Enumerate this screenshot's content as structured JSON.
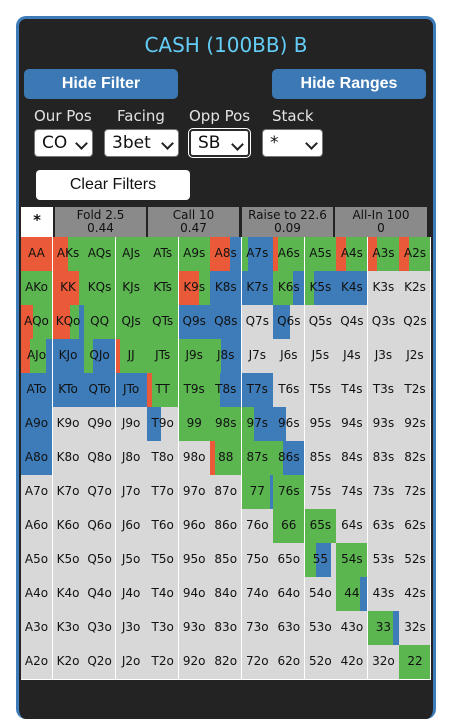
{
  "title": "CASH (100BB) B",
  "buttons": {
    "hide_filter": "Hide Filter",
    "hide_ranges": "Hide Ranges",
    "clear_filters": "Clear Filters"
  },
  "filters": [
    {
      "label": "Our Pos",
      "value": "CO"
    },
    {
      "label": "Facing",
      "value": "3bet"
    },
    {
      "label": "Opp Pos",
      "value": "SB"
    },
    {
      "label": "Stack",
      "value": "*"
    }
  ],
  "action_tabs": [
    {
      "label": "*",
      "value": ""
    },
    {
      "label": "Fold 2.5",
      "value": "0.44"
    },
    {
      "label": "Call 10",
      "value": "0.47"
    },
    {
      "label": "Raise to 22.6",
      "value": "0.09"
    },
    {
      "label": "All-In 100",
      "value": "0"
    }
  ],
  "colors": {
    "fold": "#d8d8d8",
    "call": "#5bb650",
    "raise": "#3d7cb8",
    "allin": "#eb5a38",
    "panel": "#232323",
    "accent": "#3c79b4"
  },
  "hands": [
    [
      "AA",
      "AKs",
      "AQs",
      "AJs",
      "ATs",
      "A9s",
      "A8s",
      "A7s",
      "A6s",
      "A5s",
      "A4s",
      "A3s",
      "A2s"
    ],
    [
      "AKo",
      "KK",
      "KQs",
      "KJs",
      "KTs",
      "K9s",
      "K8s",
      "K7s",
      "K6s",
      "K5s",
      "K4s",
      "K3s",
      "K2s"
    ],
    [
      "AQo",
      "KQo",
      "QQ",
      "QJs",
      "QTs",
      "Q9s",
      "Q8s",
      "Q7s",
      "Q6s",
      "Q5s",
      "Q4s",
      "Q3s",
      "Q2s"
    ],
    [
      "AJo",
      "KJo",
      "QJo",
      "JJ",
      "JTs",
      "J9s",
      "J8s",
      "J7s",
      "J6s",
      "J5s",
      "J4s",
      "J3s",
      "J2s"
    ],
    [
      "ATo",
      "KTo",
      "QTo",
      "JTo",
      "TT",
      "T9s",
      "T8s",
      "T7s",
      "T6s",
      "T5s",
      "T4s",
      "T3s",
      "T2s"
    ],
    [
      "A9o",
      "K9o",
      "Q9o",
      "J9o",
      "T9o",
      "99",
      "98s",
      "97s",
      "96s",
      "95s",
      "94s",
      "93s",
      "92s"
    ],
    [
      "A8o",
      "K8o",
      "Q8o",
      "J8o",
      "T8o",
      "98o",
      "88",
      "87s",
      "86s",
      "85s",
      "84s",
      "83s",
      "82s"
    ],
    [
      "A7o",
      "K7o",
      "Q7o",
      "J7o",
      "T7o",
      "97o",
      "87o",
      "77",
      "76s",
      "75s",
      "74s",
      "73s",
      "72s"
    ],
    [
      "A6o",
      "K6o",
      "Q6o",
      "J6o",
      "T6o",
      "96o",
      "86o",
      "76o",
      "66",
      "65s",
      "64s",
      "63s",
      "62s"
    ],
    [
      "A5o",
      "K5o",
      "Q5o",
      "J5o",
      "T5o",
      "95o",
      "85o",
      "75o",
      "65o",
      "55",
      "54s",
      "53s",
      "52s"
    ],
    [
      "A4o",
      "K4o",
      "Q4o",
      "J4o",
      "T4o",
      "94o",
      "84o",
      "74o",
      "64o",
      "54o",
      "44",
      "43s",
      "42s"
    ],
    [
      "A3o",
      "K3o",
      "Q3o",
      "J3o",
      "T3o",
      "93o",
      "83o",
      "73o",
      "63o",
      "53o",
      "43o",
      "33",
      "32s"
    ],
    [
      "A2o",
      "K2o",
      "Q2o",
      "J2o",
      "T2o",
      "92o",
      "82o",
      "72o",
      "62o",
      "52o",
      "42o",
      "32o",
      "22"
    ]
  ],
  "frequencies": [
    [
      [
        0,
        0,
        0,
        1
      ],
      [
        0,
        0.5,
        0,
        0.5
      ],
      [
        0,
        1,
        0,
        0
      ],
      [
        0,
        1,
        0,
        0
      ],
      [
        0,
        1,
        0,
        0
      ],
      [
        0,
        1,
        0,
        0
      ],
      [
        0,
        0,
        0.35,
        0.65
      ],
      [
        0,
        0.2,
        0.8,
        0
      ],
      [
        0,
        0.85,
        0,
        0.15
      ],
      [
        0,
        1,
        0,
        0
      ],
      [
        0,
        0.7,
        0,
        0.3
      ],
      [
        0,
        0.7,
        0,
        0.3
      ],
      [
        0,
        0.7,
        0,
        0.3
      ]
    ],
    [
      [
        0,
        1,
        0,
        0
      ],
      [
        0,
        0.15,
        0,
        0.85
      ],
      [
        0,
        1,
        0,
        0
      ],
      [
        0,
        1,
        0,
        0
      ],
      [
        0,
        1,
        0,
        0
      ],
      [
        0,
        0.35,
        0,
        0.65
      ],
      [
        0,
        0,
        1,
        0
      ],
      [
        0,
        0,
        1,
        0
      ],
      [
        0,
        0.65,
        0.35,
        0
      ],
      [
        0,
        0.3,
        0.7,
        0
      ],
      [
        0,
        0,
        1,
        0
      ],
      [
        1,
        0,
        0,
        0
      ],
      [
        1,
        0,
        0,
        0
      ]
    ],
    [
      [
        0,
        0.6,
        0,
        0.4
      ],
      [
        0,
        0.3,
        0.15,
        0.55
      ],
      [
        0,
        1,
        0,
        0
      ],
      [
        0,
        1,
        0,
        0
      ],
      [
        0,
        1,
        0,
        0
      ],
      [
        0,
        0,
        1,
        0
      ],
      [
        0,
        0,
        1,
        0
      ],
      [
        1,
        0,
        0,
        0
      ],
      [
        0.45,
        0,
        0.55,
        0
      ],
      [
        1,
        0,
        0,
        0
      ],
      [
        1,
        0,
        0,
        0
      ],
      [
        1,
        0,
        0,
        0
      ],
      [
        1,
        0,
        0,
        0
      ]
    ],
    [
      [
        0,
        0.5,
        0.2,
        0.3
      ],
      [
        0,
        0,
        1,
        0
      ],
      [
        0,
        0.3,
        0.7,
        0
      ],
      [
        0,
        0.85,
        0,
        0.15
      ],
      [
        0,
        1,
        0,
        0
      ],
      [
        0,
        1,
        0,
        0
      ],
      [
        0,
        0.35,
        0.65,
        0
      ],
      [
        1,
        0,
        0,
        0
      ],
      [
        1,
        0,
        0,
        0
      ],
      [
        1,
        0,
        0,
        0
      ],
      [
        1,
        0,
        0,
        0
      ],
      [
        1,
        0,
        0,
        0
      ],
      [
        1,
        0,
        0,
        0
      ]
    ],
    [
      [
        0,
        0,
        1,
        0
      ],
      [
        0,
        0,
        1,
        0
      ],
      [
        0,
        0,
        1,
        0
      ],
      [
        0,
        0,
        1,
        0
      ],
      [
        0,
        0.85,
        0,
        0.15
      ],
      [
        0,
        1,
        0,
        0
      ],
      [
        0,
        0.3,
        0.7,
        0
      ],
      [
        0,
        0,
        1,
        0
      ],
      [
        1,
        0,
        0,
        0
      ],
      [
        1,
        0,
        0,
        0
      ],
      [
        1,
        0,
        0,
        0
      ],
      [
        1,
        0,
        0,
        0
      ],
      [
        1,
        0,
        0,
        0
      ]
    ],
    [
      [
        0,
        0,
        1,
        0
      ],
      [
        1,
        0,
        0,
        0
      ],
      [
        1,
        0,
        0,
        0
      ],
      [
        1,
        0,
        0,
        0
      ],
      [
        0.55,
        0,
        0.45,
        0
      ],
      [
        0,
        1,
        0,
        0
      ],
      [
        0,
        1,
        0,
        0
      ],
      [
        0,
        0.4,
        0.6,
        0
      ],
      [
        0.6,
        0,
        0.4,
        0
      ],
      [
        1,
        0,
        0,
        0
      ],
      [
        1,
        0,
        0,
        0
      ],
      [
        1,
        0,
        0,
        0
      ],
      [
        1,
        0,
        0,
        0
      ]
    ],
    [
      [
        0,
        0,
        1,
        0
      ],
      [
        1,
        0,
        0,
        0
      ],
      [
        1,
        0,
        0,
        0
      ],
      [
        1,
        0,
        0,
        0
      ],
      [
        1,
        0,
        0,
        0
      ],
      [
        1,
        0,
        0,
        0
      ],
      [
        0,
        0.85,
        0,
        0.15
      ],
      [
        0,
        1,
        0,
        0
      ],
      [
        0,
        0.3,
        0.7,
        0
      ],
      [
        1,
        0,
        0,
        0
      ],
      [
        1,
        0,
        0,
        0
      ],
      [
        1,
        0,
        0,
        0
      ],
      [
        1,
        0,
        0,
        0
      ]
    ],
    [
      [
        1,
        0,
        0,
        0
      ],
      [
        1,
        0,
        0,
        0
      ],
      [
        1,
        0,
        0,
        0
      ],
      [
        1,
        0,
        0,
        0
      ],
      [
        1,
        0,
        0,
        0
      ],
      [
        1,
        0,
        0,
        0
      ],
      [
        1,
        0,
        0,
        0
      ],
      [
        0,
        0.9,
        0.1,
        0
      ],
      [
        0,
        1,
        0,
        0
      ],
      [
        1,
        0,
        0,
        0
      ],
      [
        1,
        0,
        0,
        0
      ],
      [
        1,
        0,
        0,
        0
      ],
      [
        1,
        0,
        0,
        0
      ]
    ],
    [
      [
        1,
        0,
        0,
        0
      ],
      [
        1,
        0,
        0,
        0
      ],
      [
        1,
        0,
        0,
        0
      ],
      [
        1,
        0,
        0,
        0
      ],
      [
        1,
        0,
        0,
        0
      ],
      [
        1,
        0,
        0,
        0
      ],
      [
        1,
        0,
        0,
        0
      ],
      [
        1,
        0,
        0,
        0
      ],
      [
        0,
        1,
        0,
        0
      ],
      [
        0,
        1,
        0,
        0
      ],
      [
        1,
        0,
        0,
        0
      ],
      [
        1,
        0,
        0,
        0
      ],
      [
        1,
        0,
        0,
        0
      ]
    ],
    [
      [
        1,
        0,
        0,
        0
      ],
      [
        1,
        0,
        0,
        0
      ],
      [
        1,
        0,
        0,
        0
      ],
      [
        1,
        0,
        0,
        0
      ],
      [
        1,
        0,
        0,
        0
      ],
      [
        1,
        0,
        0,
        0
      ],
      [
        1,
        0,
        0,
        0
      ],
      [
        1,
        0,
        0,
        0
      ],
      [
        1,
        0,
        0,
        0
      ],
      [
        0.15,
        0.35,
        0.5,
        0
      ],
      [
        0,
        1,
        0,
        0
      ],
      [
        1,
        0,
        0,
        0
      ],
      [
        1,
        0,
        0,
        0
      ]
    ],
    [
      [
        1,
        0,
        0,
        0
      ],
      [
        1,
        0,
        0,
        0
      ],
      [
        1,
        0,
        0,
        0
      ],
      [
        1,
        0,
        0,
        0
      ],
      [
        1,
        0,
        0,
        0
      ],
      [
        1,
        0,
        0,
        0
      ],
      [
        1,
        0,
        0,
        0
      ],
      [
        1,
        0,
        0,
        0
      ],
      [
        1,
        0,
        0,
        0
      ],
      [
        1,
        0,
        0,
        0
      ],
      [
        0,
        0.75,
        0.25,
        0
      ],
      [
        1,
        0,
        0,
        0
      ],
      [
        1,
        0,
        0,
        0
      ]
    ],
    [
      [
        1,
        0,
        0,
        0
      ],
      [
        1,
        0,
        0,
        0
      ],
      [
        1,
        0,
        0,
        0
      ],
      [
        1,
        0,
        0,
        0
      ],
      [
        1,
        0,
        0,
        0
      ],
      [
        1,
        0,
        0,
        0
      ],
      [
        1,
        0,
        0,
        0
      ],
      [
        1,
        0,
        0,
        0
      ],
      [
        1,
        0,
        0,
        0
      ],
      [
        1,
        0,
        0,
        0
      ],
      [
        1,
        0,
        0,
        0
      ],
      [
        0,
        0.8,
        0.2,
        0
      ],
      [
        1,
        0,
        0,
        0
      ]
    ],
    [
      [
        1,
        0,
        0,
        0
      ],
      [
        1,
        0,
        0,
        0
      ],
      [
        1,
        0,
        0,
        0
      ],
      [
        1,
        0,
        0,
        0
      ],
      [
        1,
        0,
        0,
        0
      ],
      [
        1,
        0,
        0,
        0
      ],
      [
        1,
        0,
        0,
        0
      ],
      [
        1,
        0,
        0,
        0
      ],
      [
        1,
        0,
        0,
        0
      ],
      [
        1,
        0,
        0,
        0
      ],
      [
        1,
        0,
        0,
        0
      ],
      [
        1,
        0,
        0,
        0
      ],
      [
        0,
        1,
        0,
        0
      ]
    ]
  ]
}
